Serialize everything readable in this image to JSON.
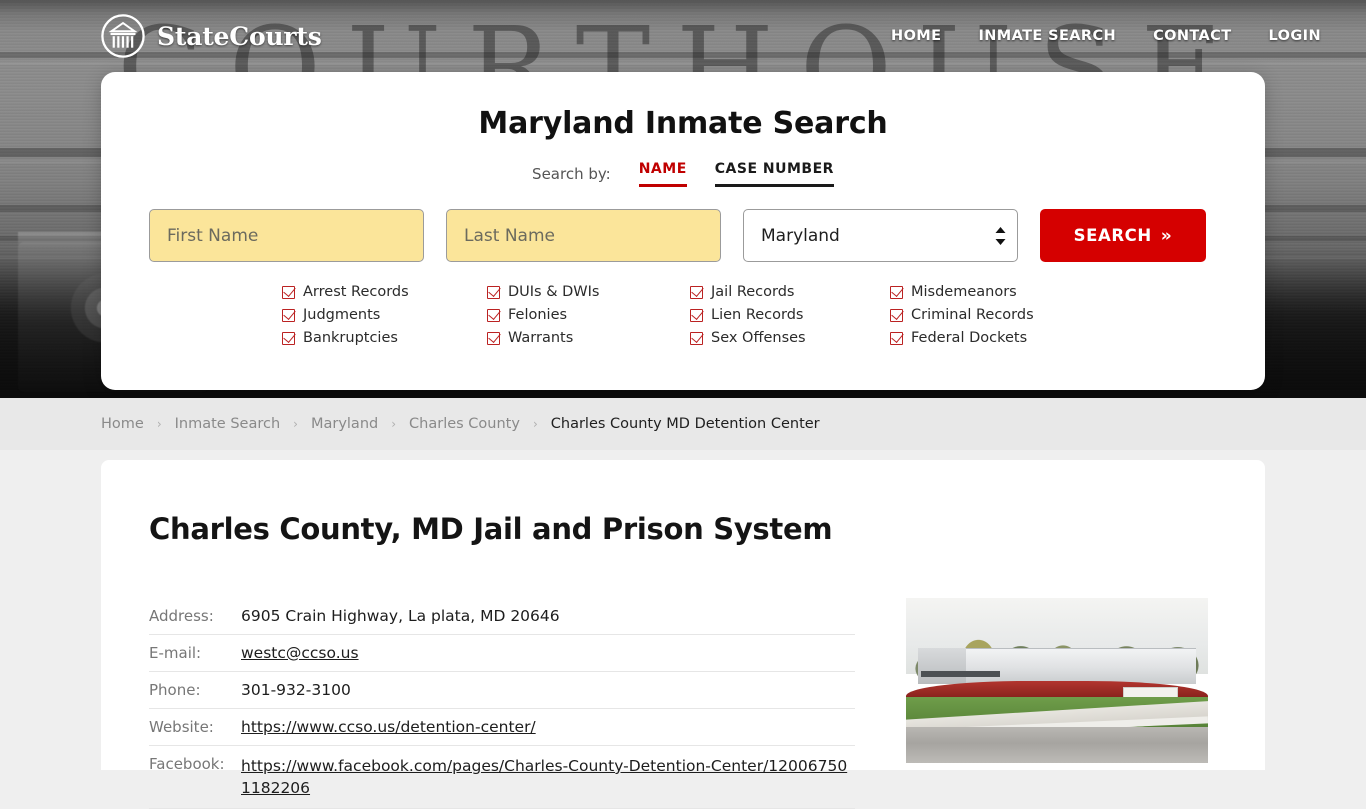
{
  "brand": {
    "name": "StateCourts",
    "logo_icon": "courthouse-circle-icon"
  },
  "nav": {
    "items": [
      {
        "label": "HOME"
      },
      {
        "label": "INMATE SEARCH"
      },
      {
        "label": "CONTACT"
      },
      {
        "label": "LOGIN"
      }
    ]
  },
  "search_card": {
    "title": "Maryland Inmate Search",
    "search_by_label": "Search by:",
    "tabs": [
      {
        "label": "NAME",
        "active": true
      },
      {
        "label": "CASE NUMBER",
        "active": false
      }
    ],
    "first_name": {
      "placeholder": "First Name",
      "value": ""
    },
    "last_name": {
      "placeholder": "Last Name",
      "value": ""
    },
    "state_select": {
      "value": "Maryland",
      "options": [
        "Maryland"
      ]
    },
    "search_button": {
      "label": "SEARCH",
      "chevron": "»"
    },
    "record_types": [
      "Arrest Records",
      "DUIs & DWIs",
      "Jail Records",
      "Misdemeanors",
      "Judgments",
      "Felonies",
      "Lien Records",
      "Criminal Records",
      "Bankruptcies",
      "Warrants",
      "Sex Offenses",
      "Federal Dockets"
    ]
  },
  "breadcrumb": {
    "separator": "›",
    "items": [
      {
        "label": "Home",
        "current": false
      },
      {
        "label": "Inmate Search",
        "current": false
      },
      {
        "label": "Maryland",
        "current": false
      },
      {
        "label": "Charles County",
        "current": false
      },
      {
        "label": "Charles County MD Detention Center",
        "current": true
      }
    ]
  },
  "page": {
    "heading": "Charles County, MD Jail and Prison System",
    "details": [
      {
        "label": "Address:",
        "value": "6905 Crain Highway, La plata, MD 20646",
        "link": false
      },
      {
        "label": "E-mail:",
        "value": "westc@ccso.us",
        "link": true
      },
      {
        "label": "Phone:",
        "value": "301-932-3100",
        "link": false
      },
      {
        "label": "Website:",
        "value": "https://www.ccso.us/detention-center/",
        "link": true
      },
      {
        "label": "Facebook:",
        "value": "https://www.facebook.com/pages/Charles-County-Detention-Center/120067501182206",
        "link": true
      }
    ],
    "facility_photo_alt": "Charles County Detention Center building exterior"
  },
  "hero": {
    "background_word": "COURTHOUSE"
  },
  "colors": {
    "accent_red": "#d50000",
    "tab_active_red": "#c00000",
    "input_yellow": "#fbe59a",
    "checkbox_red": "#bb2222",
    "breadcrumb_bg": "#e8e8e8",
    "page_bg": "#efefef"
  }
}
